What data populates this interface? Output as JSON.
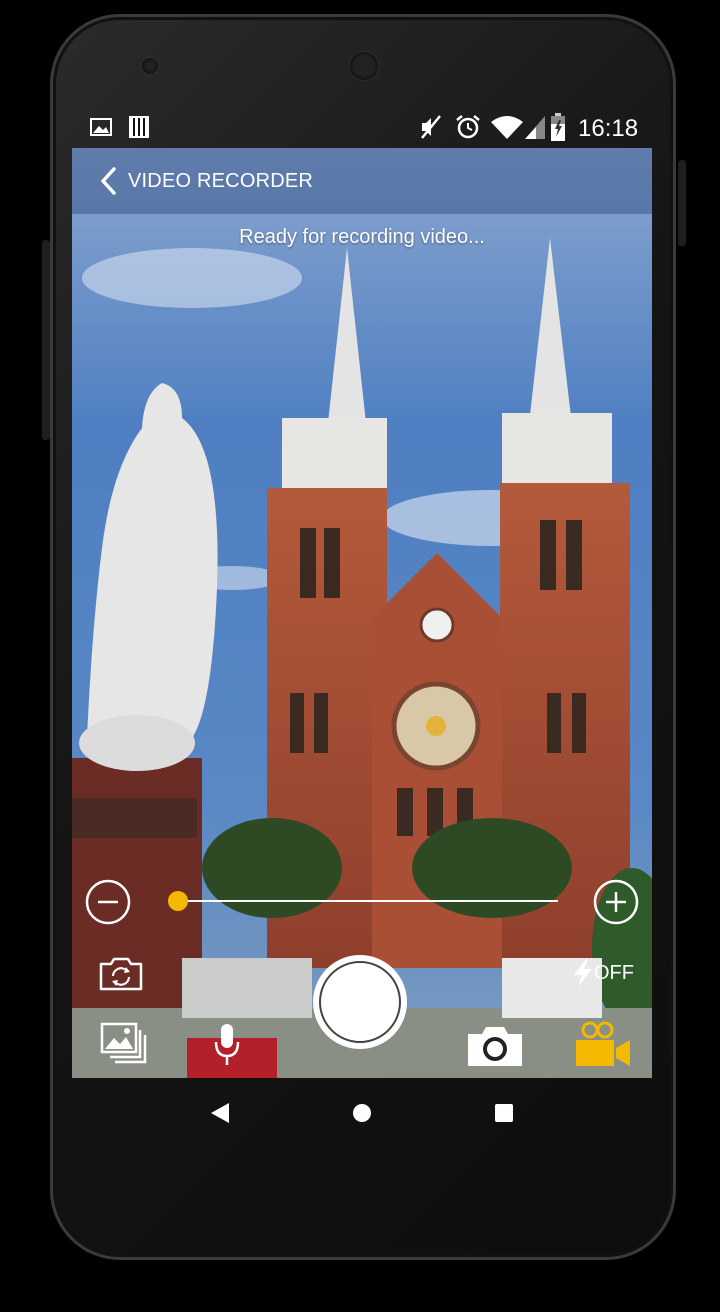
{
  "status_bar": {
    "time": "16:18",
    "icons": [
      "image-icon",
      "sd-card-icon",
      "mute-icon",
      "alarm-icon",
      "wifi-icon",
      "signal-icon",
      "battery-icon"
    ]
  },
  "app_bar": {
    "title": "VIDEO RECORDER",
    "back_icon": "chevron-left-icon"
  },
  "viewfinder": {
    "status_message": "Ready for recording video..."
  },
  "zoom": {
    "minus_icon": "zoom-out-icon",
    "plus_icon": "zoom-in-icon",
    "level": 0,
    "accent": "#f5b800"
  },
  "controls": {
    "flash_label": "OFF",
    "switch_camera_icon": "switch-camera-icon",
    "gallery_icon": "gallery-icon",
    "mic_icon": "microphone-icon",
    "photo_mode_icon": "camera-icon",
    "video_mode_icon": "video-camera-icon",
    "shutter_icon": "record-button"
  },
  "nav": {
    "back": "back-icon",
    "home": "home-icon",
    "recents": "recents-icon"
  },
  "colors": {
    "accent": "#f5b800",
    "appbar": "#3c5a8c"
  }
}
